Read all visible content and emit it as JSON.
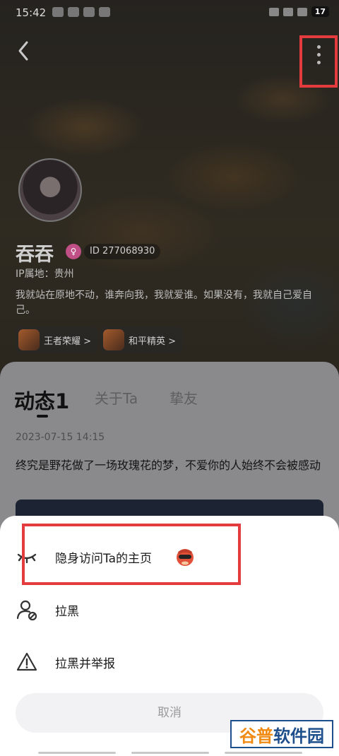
{
  "status_bar": {
    "time": "15:42",
    "battery": "17"
  },
  "header": {
    "back_icon": "chevron-left-icon",
    "more_icon": "more-vertical-icon"
  },
  "profile": {
    "nickname": "吞吞",
    "gender_icon": "female-icon",
    "id_text": "ID 277068930",
    "ip_location": "IP属地：贵州",
    "bio": "我就站在原地不动，谁奔向我，我就爱谁。如果没有，我就自己爱自己。",
    "game_tags": [
      {
        "label": "王者荣耀 >"
      },
      {
        "label": "和平精英 >"
      }
    ]
  },
  "tabs": [
    {
      "label": "动态1",
      "active": true
    },
    {
      "label": "关于Ta",
      "active": false
    },
    {
      "label": "挚友",
      "active": false
    }
  ],
  "post": {
    "date": "2023-07-15  14:15",
    "text": "终究是野花做了一场玫瑰花的梦，不爱你的人始终不会被感动"
  },
  "sheet": {
    "items": [
      {
        "label": "隐身访问Ta的主页",
        "icon": "closed-eye-icon"
      },
      {
        "label": "拉黑",
        "icon": "block-user-icon"
      },
      {
        "label": "拉黑并举报",
        "icon": "warning-icon"
      }
    ],
    "cancel": "取消"
  },
  "watermark": {
    "part1": "谷普",
    "part2": "软件园"
  },
  "colors": {
    "highlight": "#e43b3f",
    "sheet_bg": "#ffffff",
    "cancel_bg": "#f2f2f4"
  }
}
